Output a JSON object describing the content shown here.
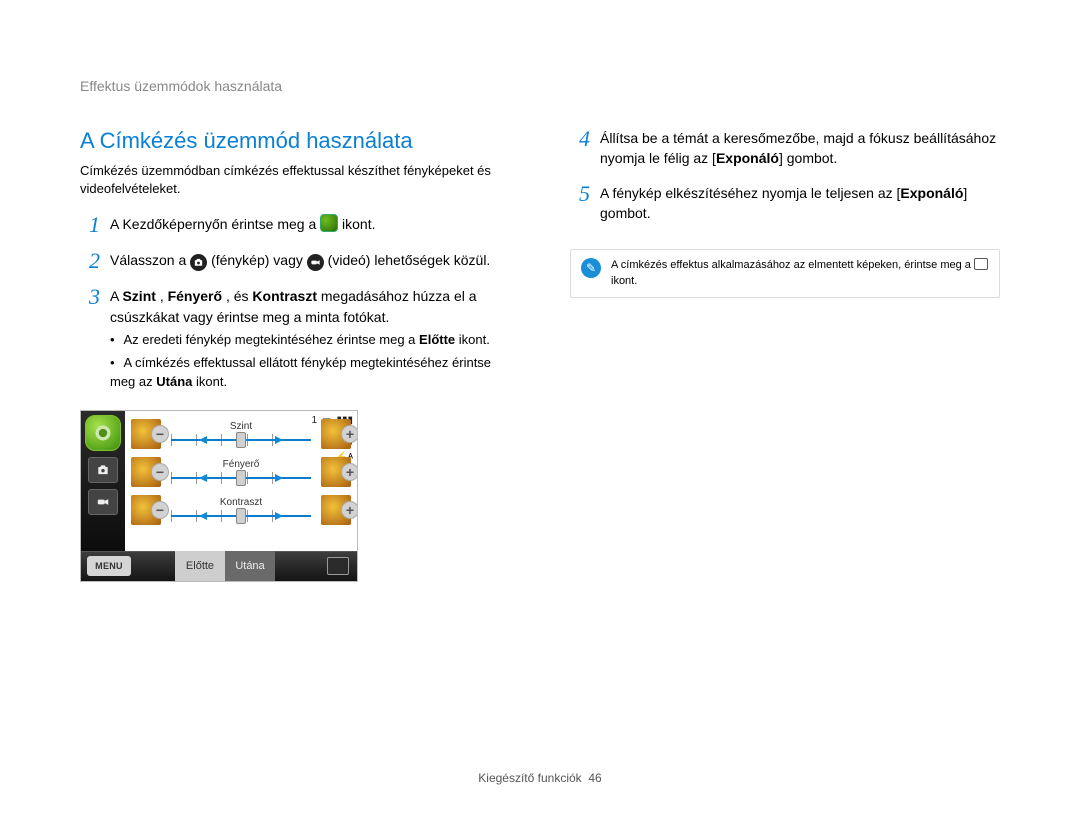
{
  "breadcrumb": "Effektus üzemmódok használata",
  "section_title": "A Címkézés üzemmód használata",
  "intro": "Címkézés üzemmódban címkézés effektussal készíthet fényképeket és videofelvételeket.",
  "left_steps": {
    "s1": {
      "num": "1",
      "pre": "A Kezdőképernyőn érintse meg a ",
      "post": " ikont."
    },
    "s2": {
      "num": "2",
      "pre": "Válasszon a ",
      "mid": " (fénykép) vagy ",
      "post": " (videó) lehetőségek közül."
    },
    "s3": {
      "num": "3",
      "pre": "A ",
      "k1": "Szint",
      "sep1": ", ",
      "k2": "Fényerő",
      "sep2": ", és ",
      "k3": "Kontraszt",
      "post": " megadásához húzza el a csúszkákat vagy érintse meg a minta fotókat.",
      "sub1_pre": "Az eredeti fénykép megtekintéséhez érintse meg a ",
      "sub1_b": "Előtte",
      "sub1_post": " ikont.",
      "sub2_pre": "A címkézés effektussal ellátott fénykép megtekintéséhez érintse meg az ",
      "sub2_b": "Utána",
      "sub2_post": " ikont."
    }
  },
  "right_steps": {
    "s4": {
      "num": "4",
      "pre": "Állítsa be a témát a keresőmezőbe, majd a fókusz beállításához nyomja le félig az [",
      "b": "Exponáló",
      "post": "] gombot."
    },
    "s5": {
      "num": "5",
      "pre": "A fénykép elkészítéséhez nyomja le teljesen az [",
      "b": "Exponáló",
      "post": "] gombot."
    }
  },
  "note": {
    "pre": "A címkézés effektus alkalmazásához az elmentett képeken, érintse meg a ",
    "post": " ikont."
  },
  "device": {
    "sliders": {
      "level": "Szint",
      "brightness": "Fényerő",
      "contrast": "Kontraszt"
    },
    "status_count": "1",
    "menu": "MENU",
    "before": "Előtte",
    "after": "Utána"
  },
  "footer": {
    "label": "Kiegészítő funkciók",
    "page": "46"
  }
}
